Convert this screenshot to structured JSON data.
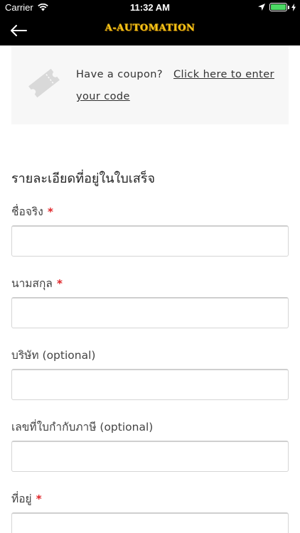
{
  "status_bar": {
    "carrier": "Carrier",
    "time": "11:32 AM",
    "battery_level": 1.0,
    "battery_color": "#4cd964"
  },
  "nav": {
    "logo_text": "A-AUTOMATION",
    "back_icon": "arrow-left-icon"
  },
  "coupon": {
    "icon": "ticket-icon",
    "prompt": "Have a coupon?",
    "link": "Click here to enter your code"
  },
  "billing": {
    "title": "รายละเอียดที่อยู่ในใบเสร็จ",
    "required_mark": "*",
    "fields": [
      {
        "label": "ชื่อจริง",
        "required": true,
        "value": ""
      },
      {
        "label": "นามสกุล",
        "required": true,
        "value": ""
      },
      {
        "label": "บริษัท (optional)",
        "required": false,
        "value": ""
      },
      {
        "label": "เลขที่ใบกำกับภาษี (optional)",
        "required": false,
        "value": ""
      },
      {
        "label": "ที่อยู่",
        "required": true,
        "value": ""
      }
    ]
  },
  "colors": {
    "header_bg": "#000000",
    "logo": "#f5c518",
    "required": "#e0262a",
    "coupon_bg": "#f7f7f7"
  }
}
